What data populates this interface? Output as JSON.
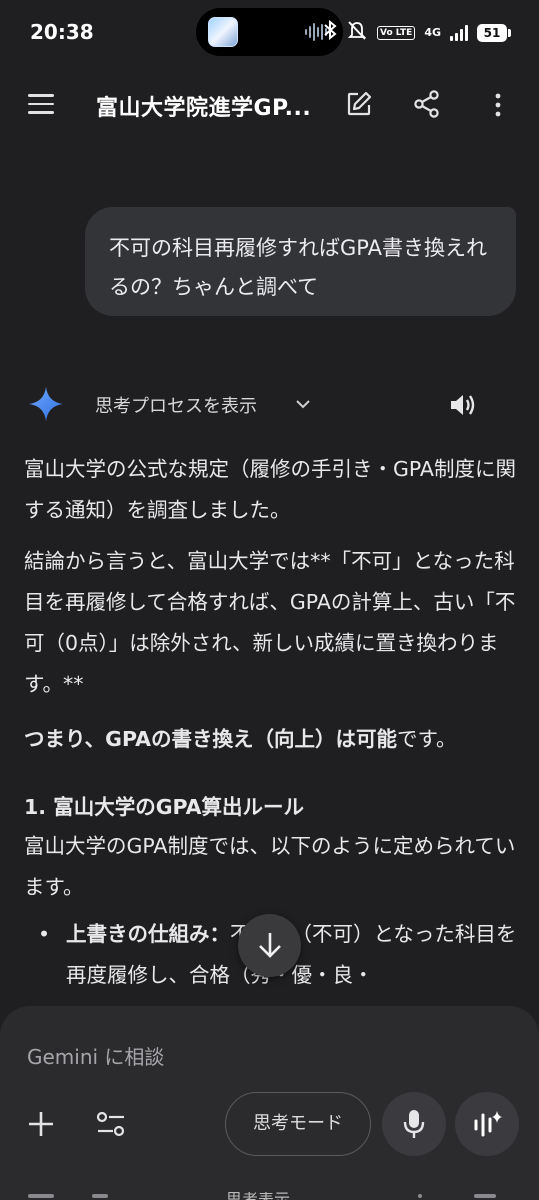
{
  "status_bar": {
    "time": "20:38",
    "volte_label": "Vo LTE",
    "network": "4G",
    "battery": "51",
    "icons": [
      "bluetooth-icon",
      "mute-icon",
      "signal-icon",
      "battery-icon"
    ]
  },
  "app_bar": {
    "title": "富山大学院進学GP...",
    "icons": [
      "menu-icon",
      "edit-icon",
      "share-icon",
      "more-vert-icon"
    ]
  },
  "user_message": {
    "text": "不可の科目再履修すればGPA書き換えれるの？ちゃんと調べて"
  },
  "response": {
    "thinking_label": "思考プロセスを表示",
    "p1": "富山大学の公式な規定（履修の手引き・GPA制度に関する通知）を調査しました。",
    "p2": "結論から言うと、富山大学では**「不可」となった科目を再履修して合格すれば、GPAの計算上、古い「不可（0点）」は除外され、新しい成績に置き換わります。**",
    "p3_bold": "つまり、GPAの書き換え（向上）は可能",
    "p3_tail": "です。",
    "heading": "1. 富山大学のGPA算出ルール",
    "p4": "富山大学のGPA制度では、以下のように定められています。",
    "bullet_bold": "上書きの仕組み：",
    "bullet_text": "不合格（不可）となった科目を再度履修し、合格（秀・優・良・"
  },
  "input_panel": {
    "placeholder": "Gemini に相談",
    "think_mode_label": "思考モード",
    "cutoff_text": "思考表示"
  },
  "colors": {
    "background": "#1f1f21",
    "bubble": "#333437",
    "panel": "#2b2b2e",
    "gemini_blue": "#4c8df6"
  }
}
